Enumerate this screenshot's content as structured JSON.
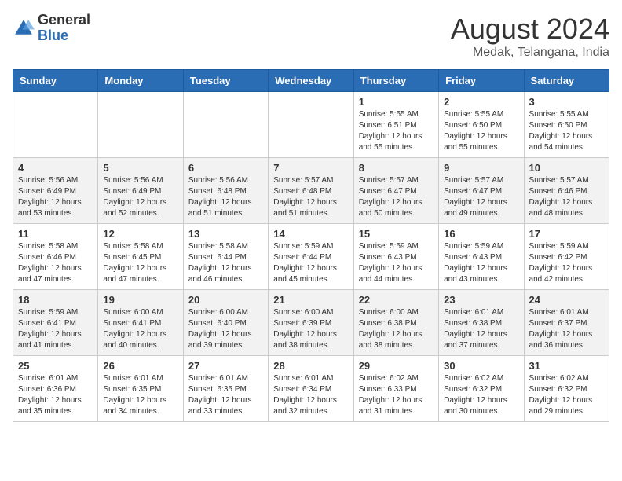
{
  "header": {
    "logo_line1": "General",
    "logo_line2": "Blue",
    "title": "August 2024",
    "location": "Medak, Telangana, India"
  },
  "days_of_week": [
    "Sunday",
    "Monday",
    "Tuesday",
    "Wednesday",
    "Thursday",
    "Friday",
    "Saturday"
  ],
  "weeks": [
    [
      {
        "num": "",
        "detail": ""
      },
      {
        "num": "",
        "detail": ""
      },
      {
        "num": "",
        "detail": ""
      },
      {
        "num": "",
        "detail": ""
      },
      {
        "num": "1",
        "detail": "Sunrise: 5:55 AM\nSunset: 6:51 PM\nDaylight: 12 hours\nand 55 minutes."
      },
      {
        "num": "2",
        "detail": "Sunrise: 5:55 AM\nSunset: 6:50 PM\nDaylight: 12 hours\nand 55 minutes."
      },
      {
        "num": "3",
        "detail": "Sunrise: 5:55 AM\nSunset: 6:50 PM\nDaylight: 12 hours\nand 54 minutes."
      }
    ],
    [
      {
        "num": "4",
        "detail": "Sunrise: 5:56 AM\nSunset: 6:49 PM\nDaylight: 12 hours\nand 53 minutes."
      },
      {
        "num": "5",
        "detail": "Sunrise: 5:56 AM\nSunset: 6:49 PM\nDaylight: 12 hours\nand 52 minutes."
      },
      {
        "num": "6",
        "detail": "Sunrise: 5:56 AM\nSunset: 6:48 PM\nDaylight: 12 hours\nand 51 minutes."
      },
      {
        "num": "7",
        "detail": "Sunrise: 5:57 AM\nSunset: 6:48 PM\nDaylight: 12 hours\nand 51 minutes."
      },
      {
        "num": "8",
        "detail": "Sunrise: 5:57 AM\nSunset: 6:47 PM\nDaylight: 12 hours\nand 50 minutes."
      },
      {
        "num": "9",
        "detail": "Sunrise: 5:57 AM\nSunset: 6:47 PM\nDaylight: 12 hours\nand 49 minutes."
      },
      {
        "num": "10",
        "detail": "Sunrise: 5:57 AM\nSunset: 6:46 PM\nDaylight: 12 hours\nand 48 minutes."
      }
    ],
    [
      {
        "num": "11",
        "detail": "Sunrise: 5:58 AM\nSunset: 6:46 PM\nDaylight: 12 hours\nand 47 minutes."
      },
      {
        "num": "12",
        "detail": "Sunrise: 5:58 AM\nSunset: 6:45 PM\nDaylight: 12 hours\nand 47 minutes."
      },
      {
        "num": "13",
        "detail": "Sunrise: 5:58 AM\nSunset: 6:44 PM\nDaylight: 12 hours\nand 46 minutes."
      },
      {
        "num": "14",
        "detail": "Sunrise: 5:59 AM\nSunset: 6:44 PM\nDaylight: 12 hours\nand 45 minutes."
      },
      {
        "num": "15",
        "detail": "Sunrise: 5:59 AM\nSunset: 6:43 PM\nDaylight: 12 hours\nand 44 minutes."
      },
      {
        "num": "16",
        "detail": "Sunrise: 5:59 AM\nSunset: 6:43 PM\nDaylight: 12 hours\nand 43 minutes."
      },
      {
        "num": "17",
        "detail": "Sunrise: 5:59 AM\nSunset: 6:42 PM\nDaylight: 12 hours\nand 42 minutes."
      }
    ],
    [
      {
        "num": "18",
        "detail": "Sunrise: 5:59 AM\nSunset: 6:41 PM\nDaylight: 12 hours\nand 41 minutes."
      },
      {
        "num": "19",
        "detail": "Sunrise: 6:00 AM\nSunset: 6:41 PM\nDaylight: 12 hours\nand 40 minutes."
      },
      {
        "num": "20",
        "detail": "Sunrise: 6:00 AM\nSunset: 6:40 PM\nDaylight: 12 hours\nand 39 minutes."
      },
      {
        "num": "21",
        "detail": "Sunrise: 6:00 AM\nSunset: 6:39 PM\nDaylight: 12 hours\nand 38 minutes."
      },
      {
        "num": "22",
        "detail": "Sunrise: 6:00 AM\nSunset: 6:38 PM\nDaylight: 12 hours\nand 38 minutes."
      },
      {
        "num": "23",
        "detail": "Sunrise: 6:01 AM\nSunset: 6:38 PM\nDaylight: 12 hours\nand 37 minutes."
      },
      {
        "num": "24",
        "detail": "Sunrise: 6:01 AM\nSunset: 6:37 PM\nDaylight: 12 hours\nand 36 minutes."
      }
    ],
    [
      {
        "num": "25",
        "detail": "Sunrise: 6:01 AM\nSunset: 6:36 PM\nDaylight: 12 hours\nand 35 minutes."
      },
      {
        "num": "26",
        "detail": "Sunrise: 6:01 AM\nSunset: 6:35 PM\nDaylight: 12 hours\nand 34 minutes."
      },
      {
        "num": "27",
        "detail": "Sunrise: 6:01 AM\nSunset: 6:35 PM\nDaylight: 12 hours\nand 33 minutes."
      },
      {
        "num": "28",
        "detail": "Sunrise: 6:01 AM\nSunset: 6:34 PM\nDaylight: 12 hours\nand 32 minutes."
      },
      {
        "num": "29",
        "detail": "Sunrise: 6:02 AM\nSunset: 6:33 PM\nDaylight: 12 hours\nand 31 minutes."
      },
      {
        "num": "30",
        "detail": "Sunrise: 6:02 AM\nSunset: 6:32 PM\nDaylight: 12 hours\nand 30 minutes."
      },
      {
        "num": "31",
        "detail": "Sunrise: 6:02 AM\nSunset: 6:32 PM\nDaylight: 12 hours\nand 29 minutes."
      }
    ]
  ]
}
